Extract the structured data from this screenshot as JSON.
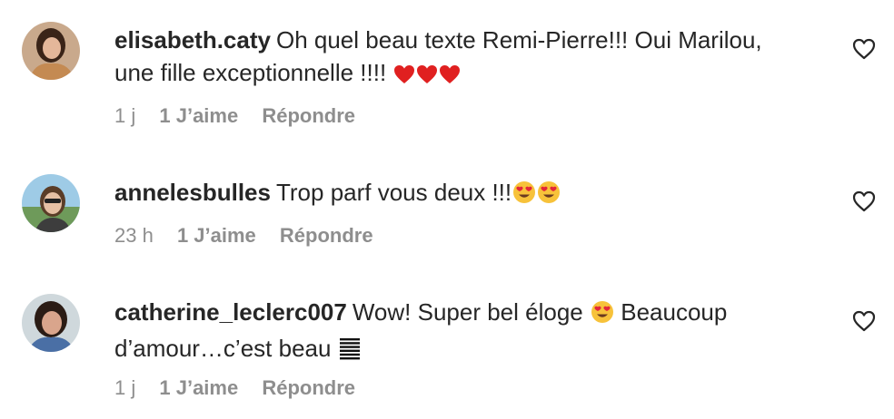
{
  "comments": [
    {
      "username": "elisabeth.caty",
      "text": "Oh quel beau texte Remi-Pierre!!! Oui Marilou, une fille exceptionnelle !!!!",
      "emoji": [
        "red-heart-emoji",
        "red-heart-emoji",
        "red-heart-emoji"
      ],
      "time": "1 j",
      "likes": "1 J’aime",
      "reply": "Répondre"
    },
    {
      "username": "annelesbulles",
      "text": "Trop parf vous deux !!!",
      "emoji": [
        "heart-eyes-emoji",
        "heart-eyes-emoji"
      ],
      "time": "23 h",
      "likes": "1 J’aime",
      "reply": "Répondre"
    },
    {
      "username": "catherine_leclerc007",
      "text_a": "Wow! Super bel éloge",
      "text_b": "Beaucoup d’amour…c’est beau",
      "emoji": [
        "heart-eyes-emoji",
        "hamburger-glyph"
      ],
      "time": "1 j",
      "likes": "1 J’aime",
      "reply": "Répondre"
    }
  ],
  "colors": {
    "text": "#262626",
    "meta": "#8e8e8e",
    "heart_emoji": "#e02020"
  }
}
